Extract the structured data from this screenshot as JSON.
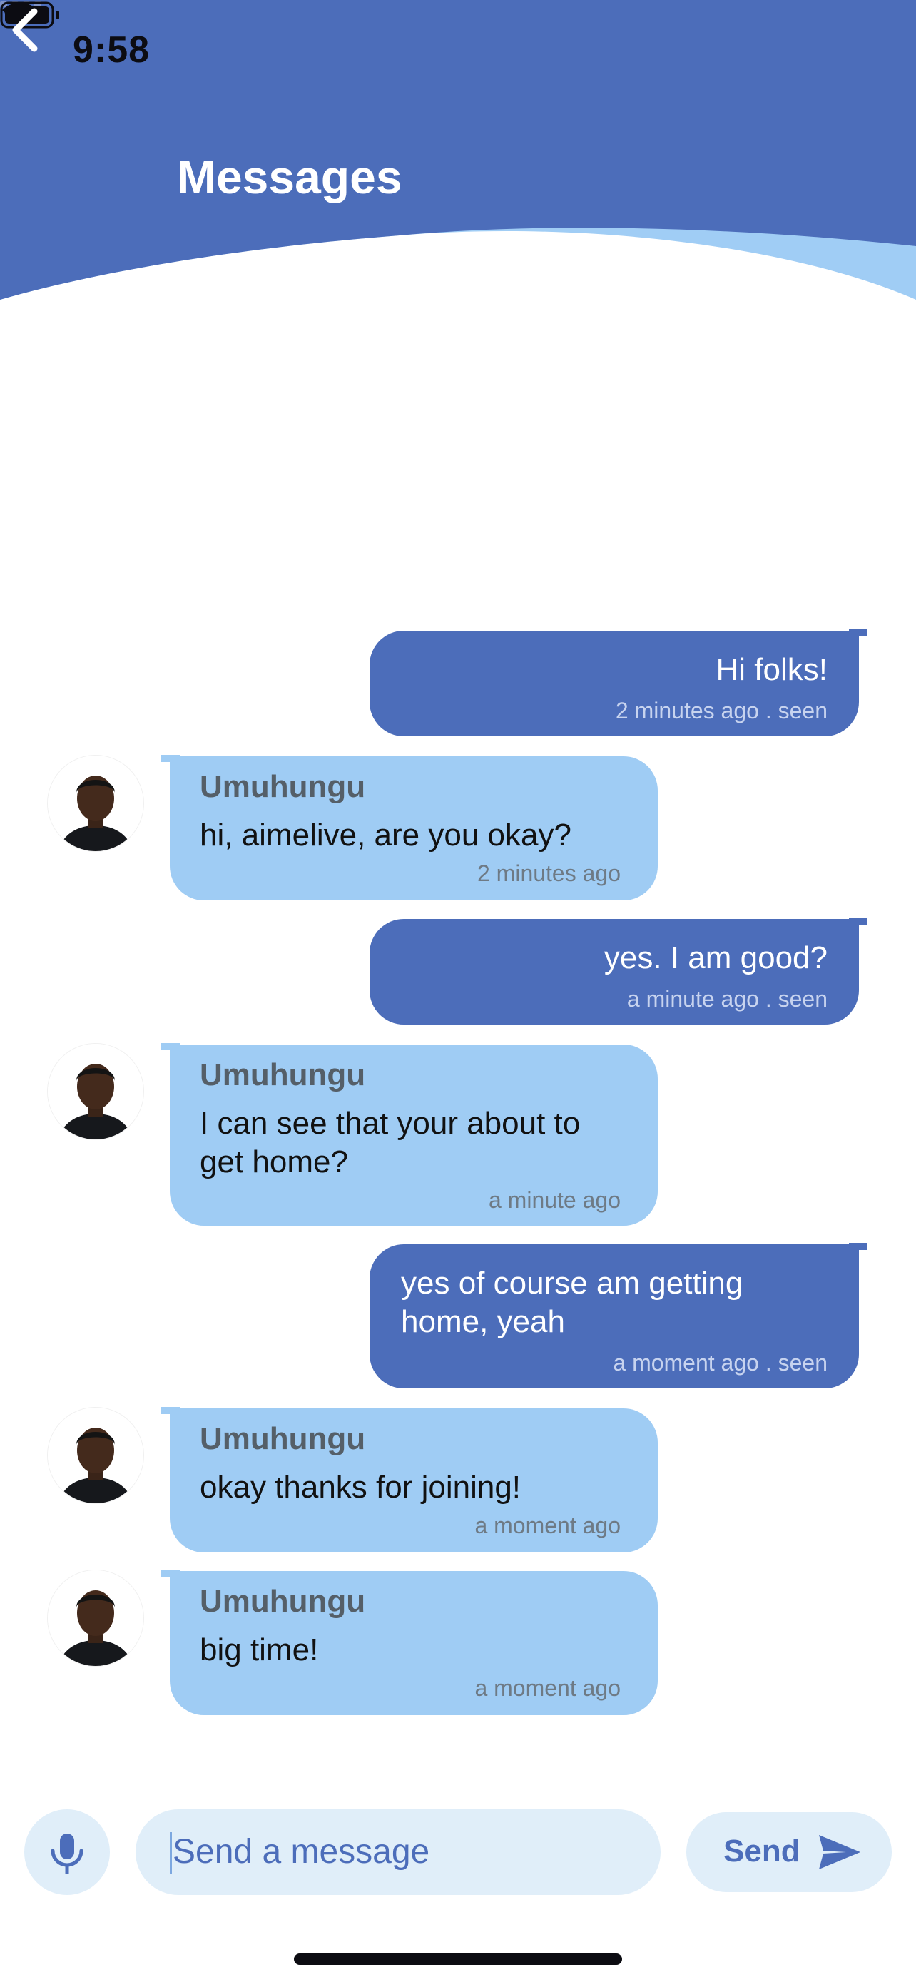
{
  "status_bar": {
    "time": "9:58"
  },
  "header": {
    "title": "Messages"
  },
  "messages": [
    {
      "direction": "out",
      "text": "Hi folks!",
      "meta": "2 minutes ago . seen"
    },
    {
      "direction": "in",
      "sender": "Umuhungu",
      "text": "hi, aimelive, are you okay?",
      "meta": "2 minutes ago"
    },
    {
      "direction": "out",
      "text": "yes. I am good?",
      "meta": "a minute ago . seen"
    },
    {
      "direction": "in",
      "sender": "Umuhungu",
      "text": "I can see that your about to get home?",
      "meta": "a minute ago"
    },
    {
      "direction": "out",
      "text": "yes of course am getting home, yeah",
      "meta": "a moment ago . seen"
    },
    {
      "direction": "in",
      "sender": "Umuhungu",
      "text": "okay thanks for joining!",
      "meta": "a moment ago"
    },
    {
      "direction": "in",
      "sender": "Umuhungu",
      "text": "big time!",
      "meta": "a moment ago"
    }
  ],
  "composer": {
    "placeholder": "Send a message",
    "send_label": "Send"
  },
  "colors": {
    "primary": "#4c6dba",
    "incoming": "#9fccf4",
    "wave": "#a0cdf5",
    "input_bg": "#e0eef9"
  }
}
